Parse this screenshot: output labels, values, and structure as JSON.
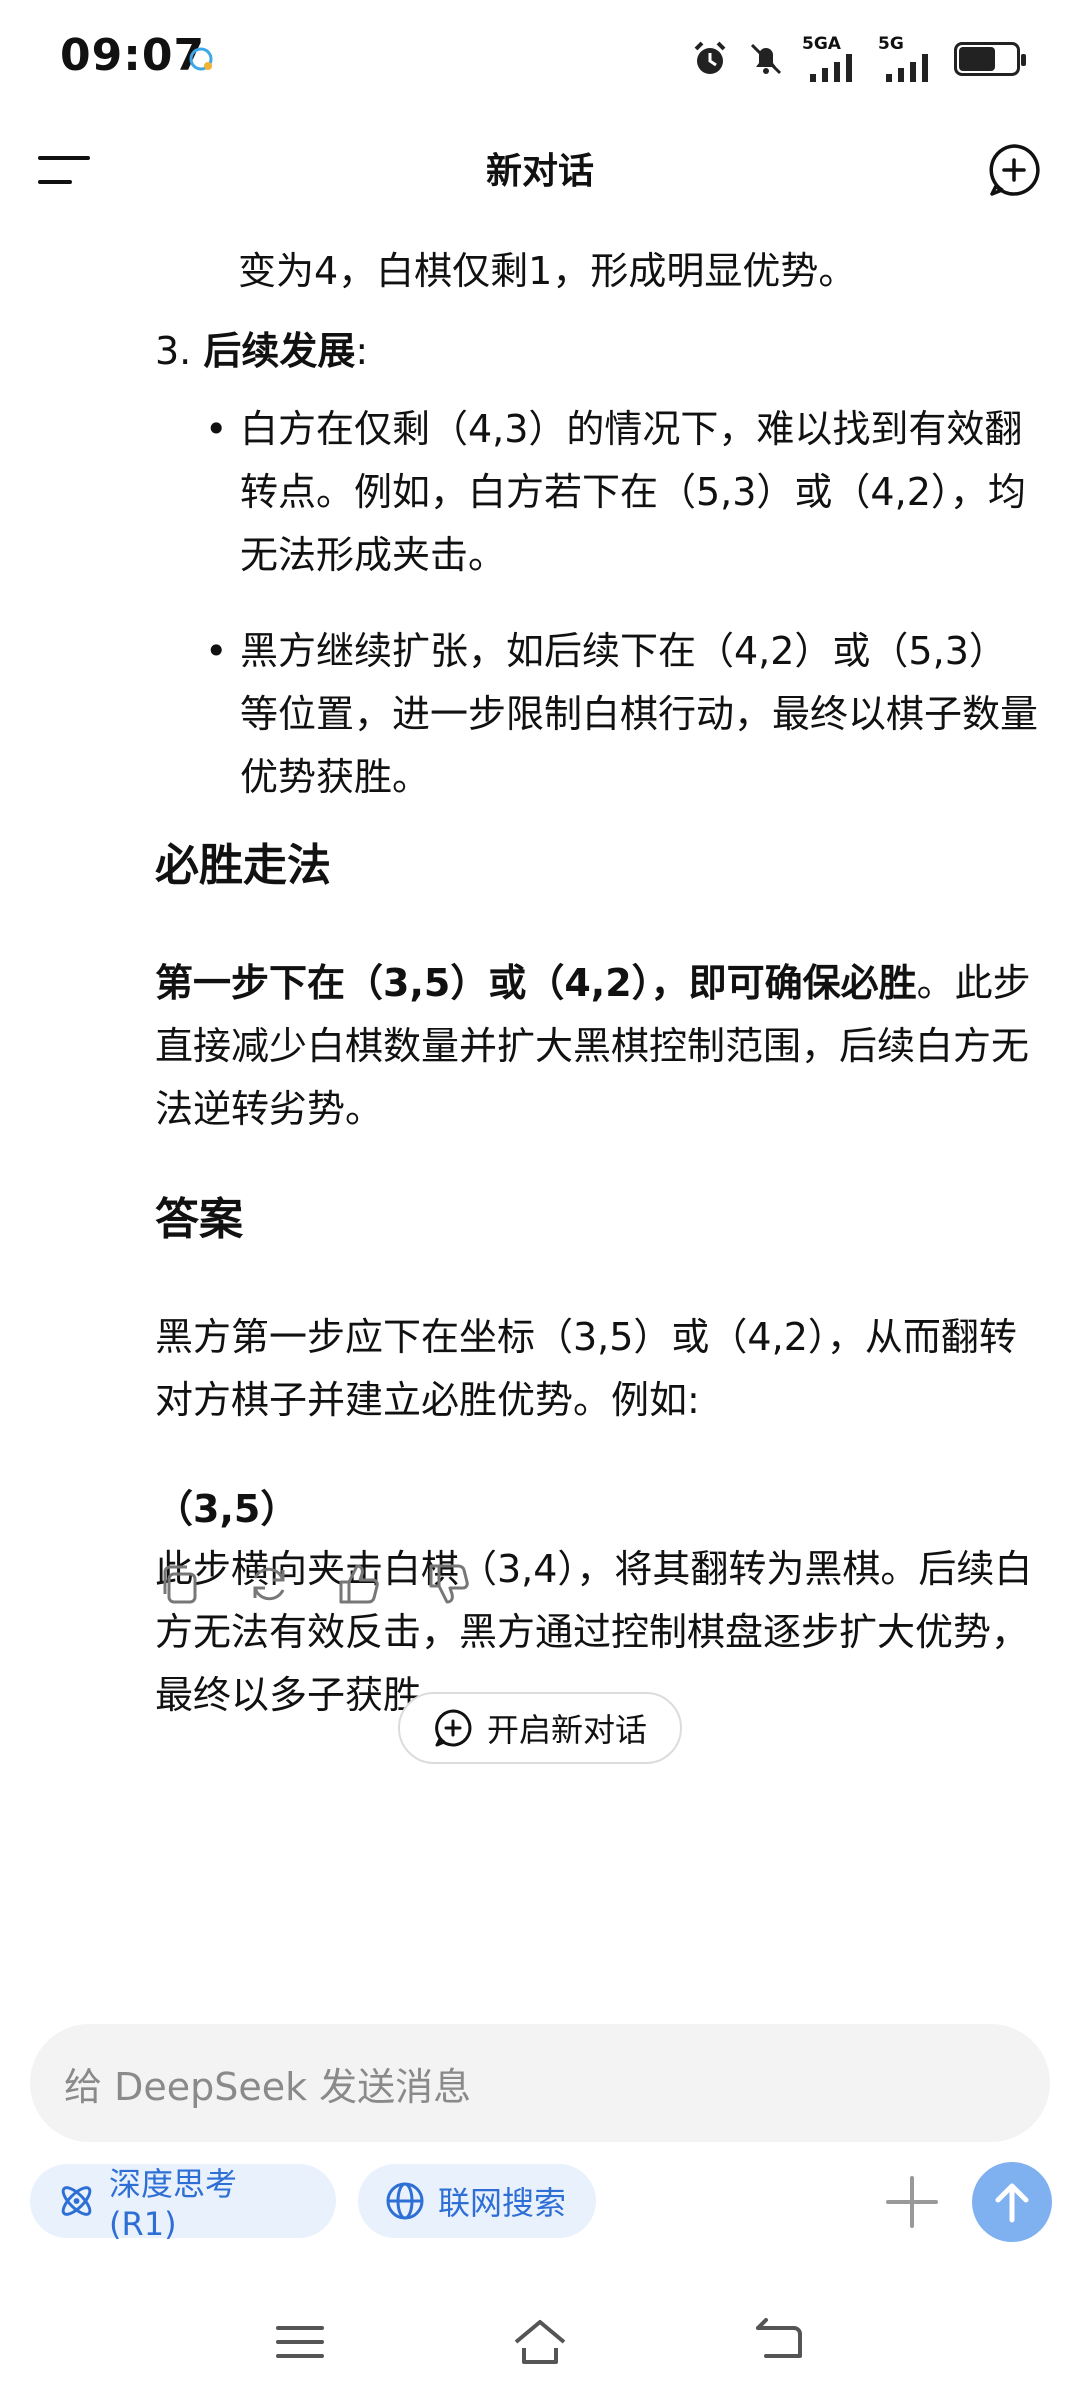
{
  "status_bar": {
    "time": "09:07",
    "network1": "5GA",
    "network2": "5G"
  },
  "header": {
    "title": "新对话"
  },
  "message": {
    "continued_line": "变为4，白棋仅剩1，形成明显优势。",
    "item3_number": "3.",
    "item3_title": "后续发展",
    "item3_colon": ":",
    "bullets": [
      "白方在仅剩（4,3）的情况下，难以找到有效翻转点。例如，白方若下在（5,3）或（4,2），均无法形成夹击。",
      "黑方继续扩张，如后续下在（4,2）或（5,3）等位置，进一步限制白棋行动，最终以棋子数量优势获胜。"
    ],
    "heading_winning": "必胜走法",
    "winning_bold": "第一步下在（3,5）或（4,2），即可确保必胜",
    "winning_rest": "。此步直接减少白棋数量并扩大黑棋控制范围，后续白方无法逆转劣势。",
    "heading_answer": "答案",
    "answer_text": "黑方第一步应下在坐标（3,5）或（4,2），从而翻转对方棋子并建立必胜优势。例如:",
    "move_label": "（3,5）",
    "move_explain": "此步横向夹击白棋（3,4），将其翻转为黑棋。后续白方无法有效反击，黑方通过控制棋盘逐步扩大优势，最终以多子获胜。"
  },
  "actions": {
    "icons": [
      "copy-icon",
      "regenerate-icon",
      "thumbs-up-icon",
      "thumbs-down-icon"
    ]
  },
  "new_chat_button": {
    "label": "开启新对话"
  },
  "input": {
    "placeholder": "给 DeepSeek 发送消息"
  },
  "chips": {
    "deep_think": "深度思考 (R1)",
    "web_search": "联网搜索"
  },
  "colors": {
    "accent": "#2e6fd6",
    "chip_bg": "#e9f1fc",
    "send_bg": "#7fb0ef"
  }
}
